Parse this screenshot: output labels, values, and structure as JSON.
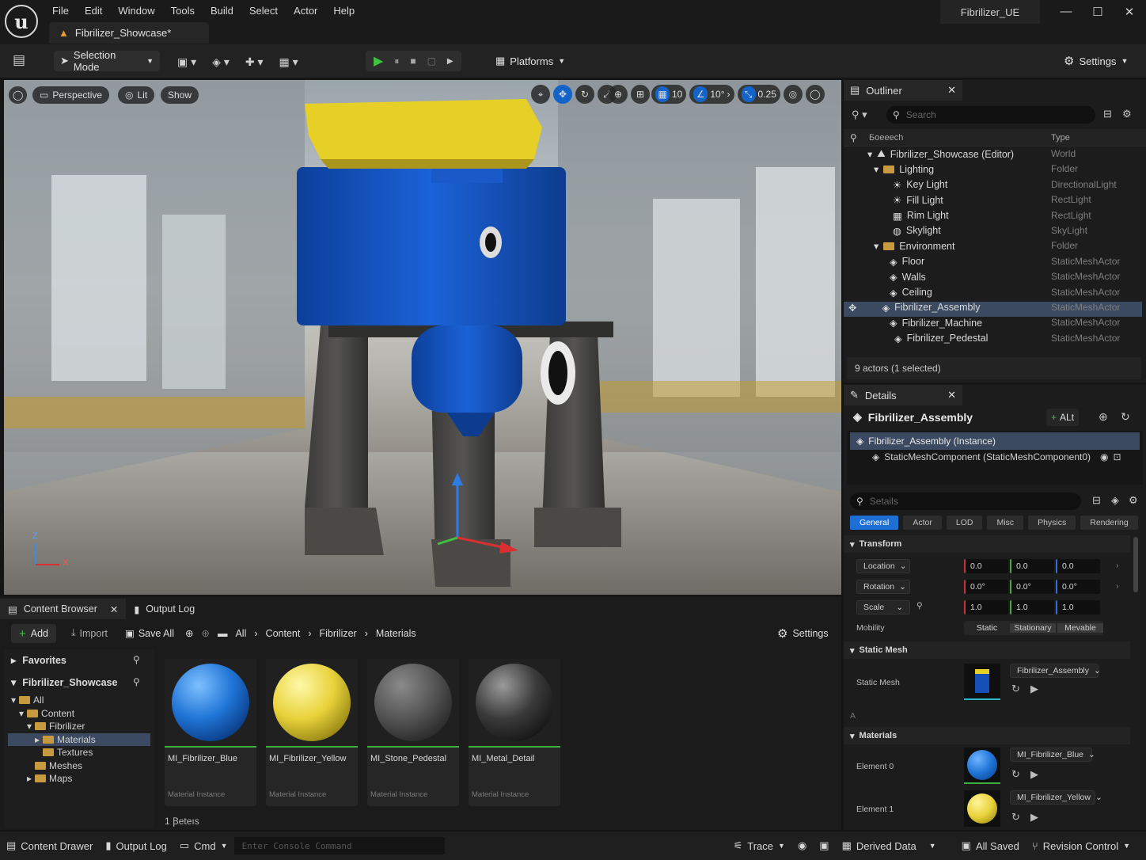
{
  "app": {
    "logo": "u",
    "project_name": "Fibrilizer_UE",
    "document_tab": "Fibrilizer_Showcase*",
    "menu": [
      "File",
      "Edit",
      "Window",
      "Tools",
      "Build",
      "Select",
      "Actor",
      "Help"
    ]
  },
  "toolbar": {
    "selection_mode": "Selection Mode",
    "platforms": "Platforms",
    "settings": "Settings"
  },
  "viewport": {
    "perspective": "Perspective",
    "lit": "Lit",
    "show": "Show",
    "snap_translate": "10",
    "snap_rotate": "10°",
    "snap_scale": "0.25",
    "axis_z": "Z",
    "axis_x": "X"
  },
  "outliner": {
    "title": "Outliner",
    "search_placeholder": "Search",
    "col_label": "Боееесh",
    "col_type": "Type",
    "rows": [
      {
        "label": "Fibrilizer_Showcase (Editor)",
        "type": "World"
      },
      {
        "label": "Lighting",
        "type": "Folder"
      },
      {
        "label": "Key Light",
        "type": "DirectionalLight"
      },
      {
        "label": "Fill Light",
        "type": "RectLight"
      },
      {
        "label": "Rim Light",
        "type": "RectLight"
      },
      {
        "label": "Skylight",
        "type": "SkyLight"
      },
      {
        "label": "Environment",
        "type": "Folder"
      },
      {
        "label": "Floor",
        "type": "StaticMeshActor"
      },
      {
        "label": "Walls",
        "type": "StaticMeshActor"
      },
      {
        "label": "Ceiling",
        "type": "StaticMeshActor"
      },
      {
        "label": "Fibrilizer_Assembly",
        "type": "StaticMeshActor"
      },
      {
        "label": "Fibrilizer_Machine",
        "type": "StaticMeshActor"
      },
      {
        "label": "Fibrilizer_Pedestal",
        "type": "StaticMeshActor"
      }
    ],
    "status": "9 actors (1 selected)"
  },
  "details": {
    "title": "Details",
    "actor_name": "Fibrilizer_Assembly",
    "add_label": "ALt",
    "instance": "Fibrilizer_Assembly (Instance)",
    "component": "StaticMeshComponent (StaticMeshComponent0)",
    "search_placeholder": "Setails",
    "tabs": [
      "General",
      "Actor",
      "LOD",
      "Misc",
      "Physics",
      "Rendering"
    ],
    "transform_header": "Transform",
    "location_label": "Location",
    "rotation_label": "Rotation",
    "scale_label": "Scale",
    "location": [
      "0.0",
      "0.0",
      "0.0"
    ],
    "rotation": [
      "0.0°",
      "0.0°",
      "0.0°"
    ],
    "scale": [
      "1.0",
      "1.0",
      "1.0"
    ],
    "mobility_label": "Mobility",
    "mobility_options": [
      "Static",
      "Stationary",
      "Mevable"
    ],
    "static_mesh_header": "Static Mesh",
    "static_mesh_label": "Static Mesh",
    "static_mesh_value": "Fibrilizer_Assembly",
    "advanced_marker": "A",
    "materials_header": "Materials",
    "element0_label": "Element 0",
    "element0_value": "MI_Fibrilizer_Blue",
    "element1_label": "Element 1",
    "element1_value": "MI_Fibrilizer_Yellow"
  },
  "content_browser": {
    "tab_label": "Content Browser",
    "output_tab": "Output Log",
    "add": "Add",
    "import": "Import",
    "save_all": "Save All",
    "breadcrumb": [
      "All",
      "Content",
      "Fibrilizer",
      "Materials"
    ],
    "settings": "Settings",
    "favorites": "Favorites",
    "project": "Fibrilizer_Showcase",
    "tree": [
      {
        "label": "All"
      },
      {
        "label": "Content"
      },
      {
        "label": "Fibrilizer"
      },
      {
        "label": "Materials"
      },
      {
        "label": "Textures"
      },
      {
        "label": "Meshes"
      },
      {
        "label": "Maps"
      }
    ],
    "assets": [
      {
        "name": "MI_Fibrilizer_Blue",
        "type": "Material Instance",
        "color": "#1f74d6"
      },
      {
        "name": "MI_Fibrilizer_Yellow",
        "type": "Material Instance",
        "color": "#e8d23a"
      },
      {
        "name": "MI_Stone_Pedestal",
        "type": "Material Instance",
        "color": "#555555"
      },
      {
        "name": "MI_Metal_Detail",
        "type": "Material Instance",
        "color": "#3a3a3a"
      }
    ],
    "item_count": "1 Ꞵeteıs"
  },
  "statusbar": {
    "content_drawer": "Content Drawer",
    "output_log": "Output Log",
    "cmd": "Cmd",
    "console_placeholder": "Enter Console Command",
    "trace": "Trace",
    "derived_data": "Derived Data",
    "all_saved": "All Saved",
    "revision_control": "Revision Control"
  },
  "colors": {
    "accent_blue": "#1d6fd6",
    "selection": "#3b4a61",
    "play_green": "#3fc23f",
    "machine_blue": "#1550b8",
    "machine_yellow": "#e6d028"
  }
}
